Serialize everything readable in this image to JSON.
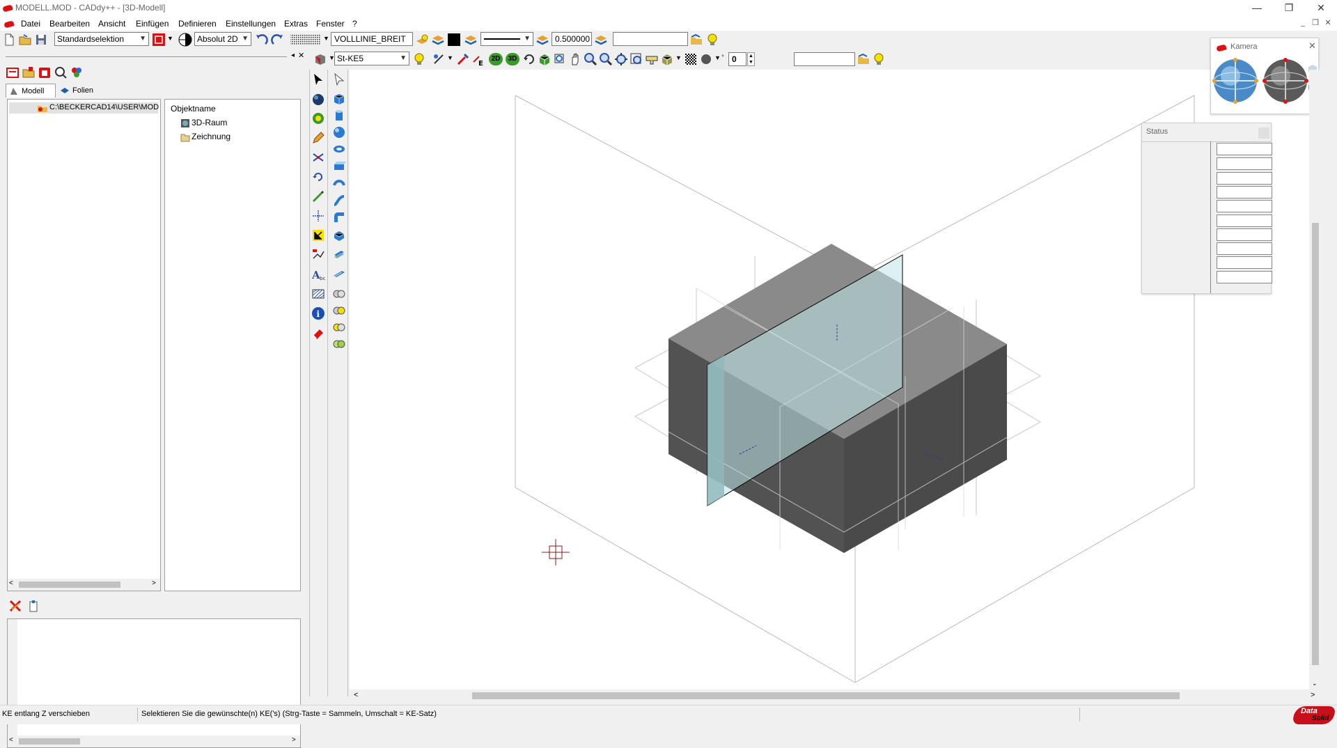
{
  "window": {
    "title": "MODELL.MOD  -  CADdy++ - [3D-Modell]",
    "minimize": "—",
    "restore": "❐",
    "close": "✕"
  },
  "menu": [
    "Datei",
    "Bearbeiten",
    "Ansicht",
    "Einfügen",
    "Definieren",
    "Einstellungen",
    "Extras",
    "Fenster",
    "?"
  ],
  "toolbar1": {
    "selection_mode": "Standardselektion",
    "coord_mode": "Absolut 2D",
    "line_type": "VOLLLINIE_BREIT",
    "line_width": "0.500000",
    "free_field": ""
  },
  "toolbar2": {
    "element_type": "St-KE5",
    "btn_2d": "2D",
    "btn_3d": "3D",
    "spin_value": "0",
    "free_field": ""
  },
  "left_panel": {
    "tabs": [
      "Modell",
      "Folien"
    ],
    "path": "C:\\BECKERCAD14\\USER\\MOD",
    "column_header": "Objektname",
    "tree_items": [
      "3D-Raum",
      "Zeichnung"
    ]
  },
  "camera_panel": {
    "title": "Kamera"
  },
  "status_panel": {
    "title": "Status",
    "rows": 10
  },
  "statusbar": {
    "command": "KE entlang Z verschieben",
    "prompt": "Selektieren Sie die gewünschte(n) KE('s) (Strg-Taste = Sammeln, Umschalt = KE-Satz)",
    "logo_top": "Data",
    "logo_bottom": "Solid"
  },
  "colors": {
    "accent_red": "#cc1111",
    "cube_top": "#8a8a8a",
    "cube_front": "#505050",
    "plane_tint": "#bfe6e8"
  }
}
